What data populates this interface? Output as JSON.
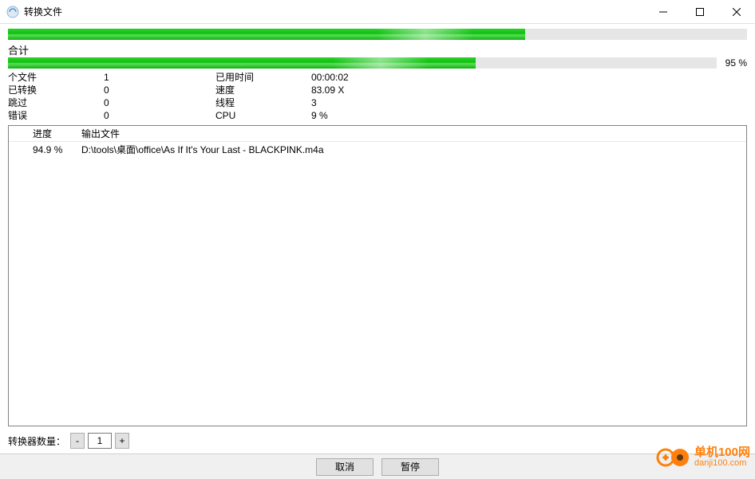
{
  "window": {
    "title": "转换文件"
  },
  "progress": {
    "top_pct": 70,
    "total_label": "合计",
    "total_pct_value": 66,
    "total_pct_text": "95 %"
  },
  "stats": {
    "rows": [
      {
        "lbl1": "个文件",
        "val1": "1",
        "lbl2": "已用时间",
        "val2": "00:00:02"
      },
      {
        "lbl1": "已转换",
        "val1": "0",
        "lbl2": "速度",
        "val2": "83.09 X"
      },
      {
        "lbl1": "跳过",
        "val1": "0",
        "lbl2": "线程",
        "val2": "3"
      },
      {
        "lbl1": "错误",
        "val1": "0",
        "lbl2": "CPU",
        "val2": "9 %"
      }
    ]
  },
  "list": {
    "headers": {
      "progress": "进度",
      "output": "输出文件"
    },
    "rows": [
      {
        "progress": "94.9 %",
        "output": "D:\\tools\\桌面\\office\\As If It's Your Last - BLACKPINK.m4a"
      }
    ]
  },
  "bottom": {
    "converter_count_label": "转换器数量：",
    "minus": "-",
    "plus": "+",
    "count": "1"
  },
  "footer": {
    "cancel": "取消",
    "pause": "暂停"
  },
  "watermark": {
    "cn": "单机100网",
    "en": "danji100.com"
  }
}
